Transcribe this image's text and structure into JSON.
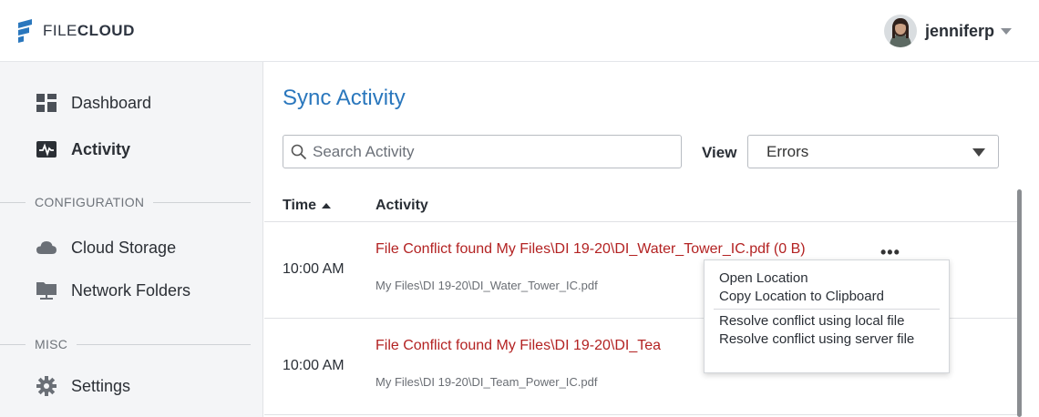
{
  "app": {
    "logo_text_a": "FILE",
    "logo_text_b": "CLOUD",
    "brand_color": "#2a77bd",
    "logo_icon": "filecloud-logo-icon"
  },
  "user": {
    "name": "jenniferp",
    "avatar_icon": "user-avatar"
  },
  "sidebar": {
    "items": [
      {
        "label": "Dashboard",
        "icon": "dashboard-icon",
        "active": false
      },
      {
        "label": "Activity",
        "icon": "activity-icon",
        "active": true
      }
    ],
    "sections": [
      {
        "label": "CONFIGURATION",
        "items": [
          {
            "label": "Cloud Storage",
            "icon": "cloud-icon"
          },
          {
            "label": "Network Folders",
            "icon": "network-folder-icon"
          }
        ]
      },
      {
        "label": "MISC",
        "items": [
          {
            "label": "Settings",
            "icon": "gear-icon"
          }
        ]
      }
    ]
  },
  "main": {
    "title": "Sync Activity",
    "search_placeholder": "Search Activity",
    "view_label": "View",
    "view_selected": "Errors",
    "columns": {
      "time": "Time",
      "activity": "Activity"
    },
    "rows": [
      {
        "time": "10:00 AM",
        "title": "File Conflict found My Files\\DI 19-20\\DI_Water_Tower_IC.pdf (0 B)",
        "path": "My Files\\DI 19-20\\DI_Water_Tower_IC.pdf",
        "more": "•••"
      },
      {
        "time": "10:00 AM",
        "title": "File Conflict found My Files\\DI 19-20\\DI_Tea",
        "path": "My Files\\DI 19-20\\DI_Team_Power_IC.pdf"
      }
    ],
    "error_color": "#b32222"
  },
  "context_menu": {
    "items": [
      "Open Location",
      "Copy Location to Clipboard",
      "Resolve conflict using local file",
      "Resolve conflict using server file"
    ]
  }
}
